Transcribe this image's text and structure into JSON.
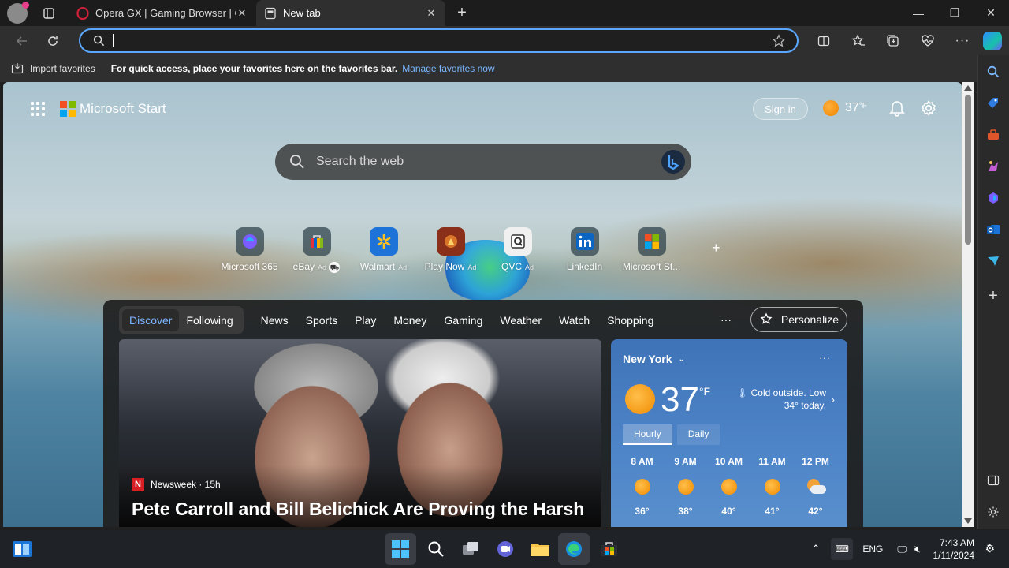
{
  "tabs": [
    {
      "title": "Opera GX | Gaming Browser | Op",
      "active": false
    },
    {
      "title": "New tab",
      "active": true
    }
  ],
  "toolbar": {
    "address_value": ""
  },
  "favorites_bar": {
    "import_label": "Import favorites",
    "message": "For quick access, place your favorites here on the favorites bar.",
    "manage_link": "Manage favorites now"
  },
  "page": {
    "brand": "Microsoft Start",
    "sign_in": "Sign in",
    "weather_temp": "37",
    "weather_unit": "°F",
    "search_placeholder": "Search the web",
    "quick_links": [
      {
        "label": "Microsoft 365",
        "ad": ""
      },
      {
        "label": "eBay",
        "ad": "Ad"
      },
      {
        "label": "Walmart",
        "ad": "Ad"
      },
      {
        "label": "Play Now",
        "ad": "Ad"
      },
      {
        "label": "QVC",
        "ad": "Ad"
      },
      {
        "label": "LinkedIn",
        "ad": ""
      },
      {
        "label": "Microsoft St...",
        "ad": ""
      }
    ],
    "feed_tabs_pill": [
      "Discover",
      "Following"
    ],
    "feed_tabs": [
      "News",
      "Sports",
      "Play",
      "Money",
      "Gaming",
      "Weather",
      "Watch",
      "Shopping"
    ],
    "more": "···",
    "personalize": "Personalize",
    "hero": {
      "source": "Newsweek · 15h",
      "source_logo": "N",
      "headline": "Pete Carroll and Bill Belichick Are Proving the Harsh"
    },
    "weather_card": {
      "city": "New York",
      "more": "···",
      "temp": "37",
      "unit": "°F",
      "message": "Cold outside. Low 34° today.",
      "tabs": [
        "Hourly",
        "Daily"
      ],
      "hours": [
        {
          "time": "8 AM",
          "temp": "36°",
          "icon": "sun"
        },
        {
          "time": "9 AM",
          "temp": "38°",
          "icon": "sun"
        },
        {
          "time": "10 AM",
          "temp": "40°",
          "icon": "sun"
        },
        {
          "time": "11 AM",
          "temp": "41°",
          "icon": "sun"
        },
        {
          "time": "12 PM",
          "temp": "42°",
          "icon": "partly-cloudy"
        }
      ]
    }
  },
  "taskbar": {
    "language": "ENG",
    "time": "7:43 AM",
    "date": "1/11/2024"
  },
  "colors": {
    "accent": "#5aa7ff",
    "link": "#7ab7ff"
  }
}
